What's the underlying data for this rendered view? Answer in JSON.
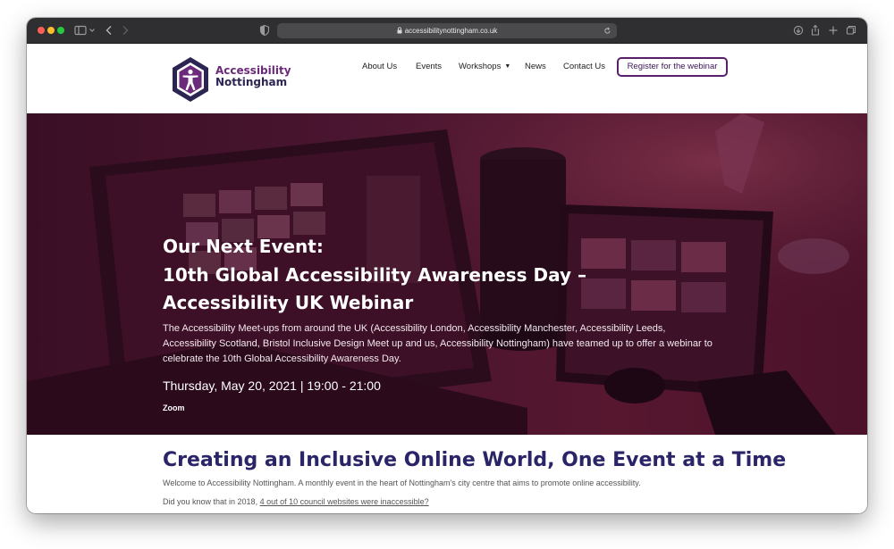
{
  "browser": {
    "url": "accessibilitynottingham.co.uk",
    "icons": [
      "sidebar-icon",
      "chevron-down-icon",
      "back-icon",
      "forward-icon",
      "privacy-shield-icon",
      "lock-icon",
      "reload-icon",
      "download-icon",
      "share-icon",
      "new-tab-icon",
      "tabs-overview-icon"
    ]
  },
  "site": {
    "logo": {
      "line1": "Accessibility",
      "line2": "Nottingham",
      "icon": "accessibility-person-icon"
    },
    "nav": [
      "About Us",
      "Events",
      "Workshops",
      "News",
      "Contact Us"
    ],
    "register_label": "Register for the webinar"
  },
  "hero": {
    "eyebrow": "Our Next Event:",
    "title": "10th Global Accessibility Awareness Day – Accessibility UK Webinar",
    "description": "The Accessibility Meet-ups from around the UK (Accessibility London, Accessibility Manchester, Accessibility Leeds, Accessibility Scotland, Bristol Inclusive Design Meet up and us, Accessibility Nottingham) have teamed up to offer a webinar to celebrate the 10th Global Accessibility Awareness Day.",
    "datetime": "Thursday, May 20, 2021 | 19:00 - 21:00",
    "location": "Zoom"
  },
  "intro": {
    "heading": "Creating an Inclusive Online World, One Event at a Time",
    "text": "Welcome to Accessibility Nottingham. A monthly event in the heart of Nottingham's city centre that aims to promote online accessibility.",
    "question_prefix": "Did you know that in 2018, ",
    "question_link": "4 out of 10 council websites were inaccessible?"
  },
  "colors": {
    "brand_purple": "#6b2a7a",
    "brand_navy": "#2c2551",
    "heading_navy": "#2a2468",
    "hero_overlay": "#4a1530"
  }
}
